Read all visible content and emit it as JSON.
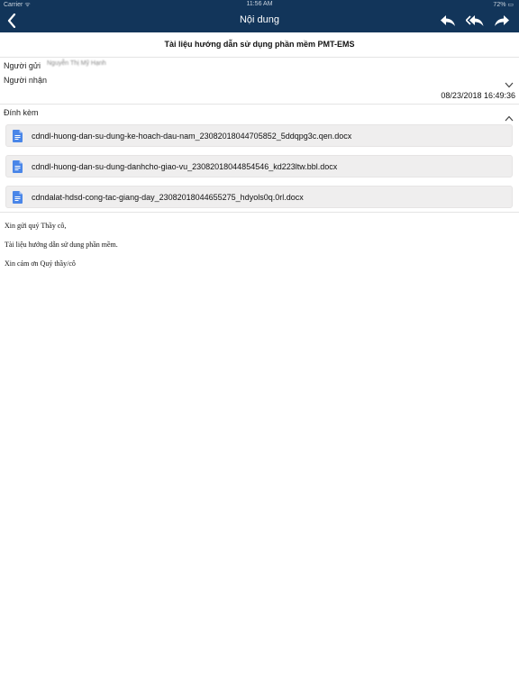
{
  "status_bar": {
    "carrier": "Carrier ᯤ",
    "time": "11:56 AM",
    "battery": "72% ▭"
  },
  "nav": {
    "title": "Nội dung"
  },
  "email": {
    "subject": "Tài liệu hướng dẫn sử dụng phần mềm PMT-EMS",
    "sender_label": "Người gửi",
    "sender_value": "Nguyễn Thị Mỹ Hạnh",
    "recipient_label": "Người nhận",
    "date": "08/23/2018 16:49:36",
    "attachments_label": "Đính kèm",
    "attachments": [
      {
        "name": "cdndl-huong-dan-su-dung-ke-hoach-dau-nam_23082018044705852_5ddqpg3c.qen.docx"
      },
      {
        "name": "cdndl-huong-dan-su-dung-danhcho-giao-vu_23082018044854546_kd223ltw.bbl.docx"
      },
      {
        "name": "cdndalat-hdsd-cong-tac-giang-day_23082018044655275_hdyols0q.0rl.docx"
      }
    ],
    "body_lines": [
      "Xin gửi quý Thầy cô,",
      "Tài liệu hướng dẫn sử dung phần mềm.",
      "Xin cám ơn Quý thầy/cô"
    ]
  },
  "colors": {
    "nav_bg": "#12355a",
    "attachment_bg": "#efeeee",
    "doc_icon": "#4a86e8"
  }
}
